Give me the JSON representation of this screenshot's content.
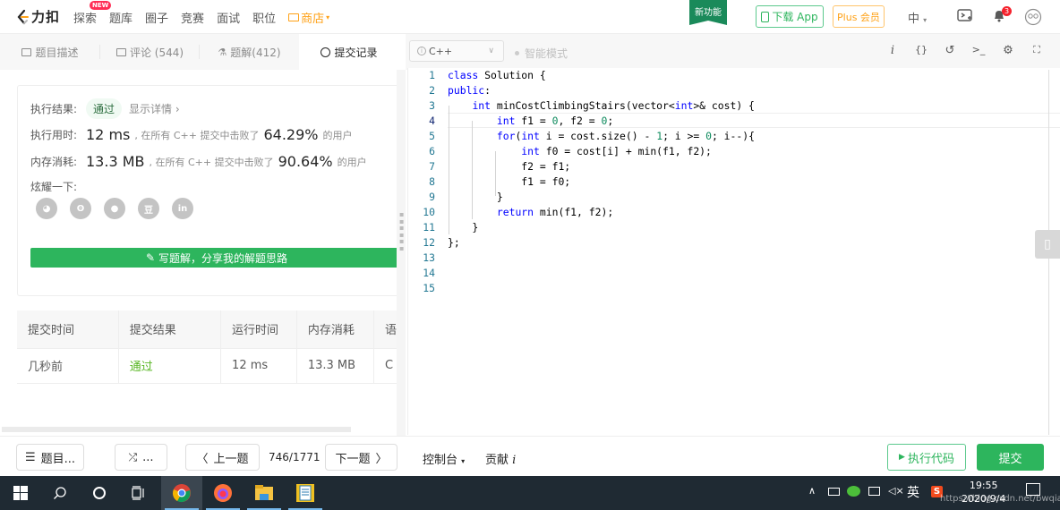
{
  "topnav": {
    "logo_text": "力扣",
    "items": [
      {
        "label": "探索",
        "badge": "NEW"
      },
      {
        "label": "题库"
      },
      {
        "label": "圈子"
      },
      {
        "label": "竞赛"
      },
      {
        "label": "面试"
      },
      {
        "label": "职位"
      },
      {
        "label": "商店"
      }
    ],
    "feature_flag": "新功能",
    "download_app": "下载 App",
    "plus": "Plus 会员",
    "language": "中",
    "notification_count": "3",
    "colors": {
      "brand_orange": "#ffa116",
      "green": "#2db55d"
    }
  },
  "left_tabs": [
    {
      "label": "题目描述",
      "icon": "description-icon"
    },
    {
      "label": "评论 (544)",
      "icon": "comment-icon"
    },
    {
      "label": "题解(412)",
      "icon": "flask-icon"
    },
    {
      "label": "提交记录",
      "icon": "clock-icon",
      "active": true
    }
  ],
  "result": {
    "result_label": "执行结果:",
    "result_value": "通过",
    "show_detail": "显示详情 ›",
    "time_label": "执行用时:",
    "time_value": "12 ms",
    "time_text": ", 在所有 C++ 提交中击败了",
    "time_percent": "64.29%",
    "time_suffix": "的用户",
    "memory_label": "内存消耗:",
    "memory_value": "13.3 MB",
    "memory_text": ", 在所有 C++ 提交中击败了",
    "memory_percent": "90.64%",
    "memory_suffix": "的用户",
    "share_label": "炫耀一下:",
    "share_icons": [
      "wechat-icon",
      "weibo-icon",
      "qq-icon",
      "douban-icon",
      "linkedin-icon"
    ],
    "share_glyphs": [
      "◕",
      "ʘ",
      "●",
      "豆",
      "in"
    ],
    "write_solution": "写题解，分享我的解题思路"
  },
  "submissions": {
    "headers": [
      "提交时间",
      "提交结果",
      "运行时间",
      "内存消耗",
      "语"
    ],
    "rows": [
      [
        "几秒前",
        "通过",
        "12 ms",
        "13.3 MB",
        "C"
      ]
    ]
  },
  "editor": {
    "language": "C++",
    "smart_mode": "智能模式",
    "lines": [
      "1",
      "2",
      "3",
      "4",
      "5",
      "6",
      "7",
      "8",
      "9",
      "10",
      "11",
      "12",
      "13",
      "14",
      "15"
    ]
  },
  "bottom": {
    "problem_list": "题目...",
    "random": "...",
    "prev": "上一题",
    "counter": "746/1771",
    "next": "下一题",
    "console": "控制台",
    "contribute": "贡献",
    "run": "执行代码",
    "submit": "提交"
  },
  "taskbar": {
    "ime": "英",
    "time": "19:55",
    "date": "2020/9/4",
    "watermark": "https://blog.csdn.net/bwqiang"
  }
}
